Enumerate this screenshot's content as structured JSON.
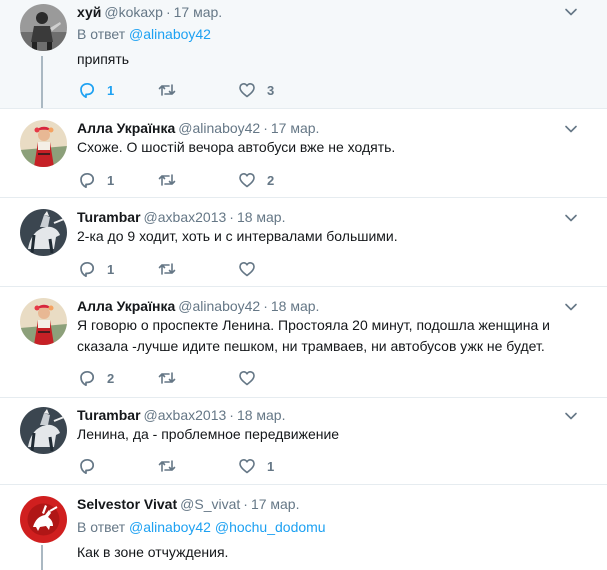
{
  "tweets": [
    {
      "fullname": "хуй",
      "username": "@kokaxp",
      "separator": "·",
      "time": "17 мар.",
      "reply_prefix": "В ответ",
      "mentions": [
        "@alinaboy42"
      ],
      "text": "припять",
      "replies": "1",
      "retweets": "",
      "likes": "3",
      "avatar": "bw-figure-avatar"
    },
    {
      "fullname": "Алла Українка",
      "username": "@alinaboy42",
      "separator": "·",
      "time": "17 мар.",
      "text": "Схоже. О шостій вечора автобуси вже не ходять.",
      "replies": "1",
      "retweets": "",
      "likes": "2",
      "avatar": "red-folk-dress-avatar"
    },
    {
      "fullname": "Turambar",
      "username": "@axbax2013",
      "separator": "·",
      "time": "18 мар.",
      "text": "2-ка до 9 ходит, хоть и с интервалами большими.",
      "replies": "1",
      "retweets": "",
      "likes": "",
      "avatar": "knight-horse-avatar"
    },
    {
      "fullname": "Алла Українка",
      "username": "@alinaboy42",
      "separator": "·",
      "time": "18 мар.",
      "text_lines": [
        "Я говорю о проспекте Ленина. Простояла 20 минут, подошла  женщина и",
        "сказала -лучше идите пешком, ни трамваев, ни автобусов ужк не будет."
      ],
      "replies": "2",
      "retweets": "",
      "likes": "",
      "avatar": "red-folk-dress-avatar"
    },
    {
      "fullname": "Turambar",
      "username": "@axbax2013",
      "separator": "·",
      "time": "18 мар.",
      "text": "Ленина, да - проблемное передвижение",
      "replies": "",
      "retweets": "",
      "likes": "1",
      "avatar": "knight-horse-avatar"
    },
    {
      "fullname": "Selvestor Vivat",
      "username": "@S_vivat",
      "separator": "·",
      "time": "17 мар.",
      "reply_prefix": "В ответ",
      "mentions": [
        "@alinaboy42",
        "@hochu_dodomu"
      ],
      "text": "Как в зоне отчуждения.",
      "avatar": "red-pahonia-avatar"
    }
  ],
  "colors": {
    "accent": "#1da1f2",
    "muted": "#657786",
    "text": "#14171a",
    "thread_line": "#aab8c2",
    "highlight_bg": "#f5f8fa"
  },
  "icons": {
    "reply": "reply-bubble-icon",
    "retweet": "retweet-arrows-icon",
    "like": "heart-icon",
    "menu": "chevron-down-icon"
  }
}
